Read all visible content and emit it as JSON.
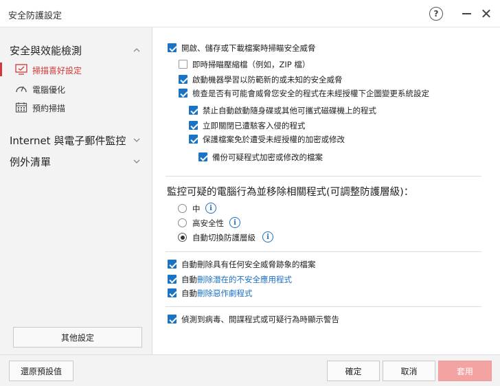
{
  "window": {
    "title": "安全防護設定",
    "help_symbol": "?",
    "close_symbol": "✕"
  },
  "sidebar": {
    "section1": "安全與效能檢測",
    "items": [
      {
        "label": "掃描喜好設定",
        "icon": "scan-screen-icon",
        "active": true
      },
      {
        "label": "電腦優化",
        "icon": "speedometer-icon",
        "active": false
      },
      {
        "label": "預約掃描",
        "icon": "calendar-icon",
        "active": false
      }
    ],
    "section2": "Internet 與電子郵件監控",
    "section3": "例外清單",
    "other_settings": "其他設定"
  },
  "options": {
    "scan_on_open": {
      "label": "開啟、儲存或下載檔案時掃瞄安全威脅",
      "checked": true
    },
    "scan_archives": {
      "label": "即時掃瞄壓縮檔（例如，ZIP 檔）",
      "checked": false
    },
    "machine_learning": {
      "label": "啟動機器學習以防範新的或未知的安全威脅",
      "checked": true
    },
    "check_unauthorized": {
      "label": "檢查是否有可能會威脅您安全的程式在未經授權下企圖變更系統設定",
      "checked": true
    },
    "block_autorun": {
      "label": "禁止自動啟動隨身碟或其他可攜式磁碟機上的程式",
      "checked": true
    },
    "close_hijacked": {
      "label": "立即關閉已遭駭客入侵的程式",
      "checked": true
    },
    "protect_files": {
      "label": "保護檔案免於遭受未經授權的加密或修改",
      "checked": true
    },
    "backup_files": {
      "label": "備份可疑程式加密或修改的檔案",
      "checked": true
    }
  },
  "monitor": {
    "heading": "監控可疑的電腦行為並移除相關程式(可調整防護層級)：",
    "levels": [
      {
        "label": "中",
        "selected": false
      },
      {
        "label": "高安全性",
        "selected": false
      },
      {
        "label": "自動切換防護層級",
        "selected": true
      }
    ],
    "info_symbol": "i"
  },
  "removal": {
    "delete_threat_files": {
      "label": "自動刪除具有任何安全威脅跡象的檔案",
      "checked": true
    },
    "delete_pua": {
      "prefix": "自動",
      "link": "刪除潛在的不安全應用程式",
      "checked": true
    },
    "delete_joke": {
      "prefix": "自動",
      "link": "刪除惡作劇程式",
      "checked": true
    }
  },
  "warnings": {
    "show_warning": {
      "label": "偵測到病毒、間諜程式或可疑行為時顯示警告",
      "checked": true
    }
  },
  "footer": {
    "restore": "還原預設值",
    "ok": "確定",
    "cancel": "取消",
    "apply": "套用"
  },
  "colors": {
    "accent": "#1a73c4",
    "active_nav": "#d03a3a",
    "apply_disabled": "#f4a3a3"
  }
}
